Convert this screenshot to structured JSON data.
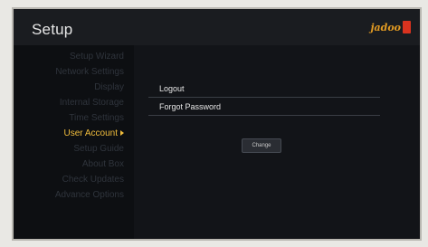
{
  "header": {
    "title": "Setup",
    "logo": "jadoo"
  },
  "sidebar": {
    "items": [
      {
        "label": "Setup Wizard"
      },
      {
        "label": "Network Settings"
      },
      {
        "label": "Display"
      },
      {
        "label": "Internal Storage"
      },
      {
        "label": "Time Settings"
      },
      {
        "label": "User Account",
        "active": true
      },
      {
        "label": "Setup Guide"
      },
      {
        "label": "About Box"
      },
      {
        "label": "Check Updates"
      },
      {
        "label": "Advance Options"
      }
    ]
  },
  "content": {
    "options": [
      {
        "label": "Logout"
      },
      {
        "label": "Forgot Password"
      }
    ],
    "change_button": "Change"
  },
  "colors": {
    "accent": "#f1bd3c",
    "logo": "#e19a22",
    "logo_mark": "#d9331f"
  }
}
